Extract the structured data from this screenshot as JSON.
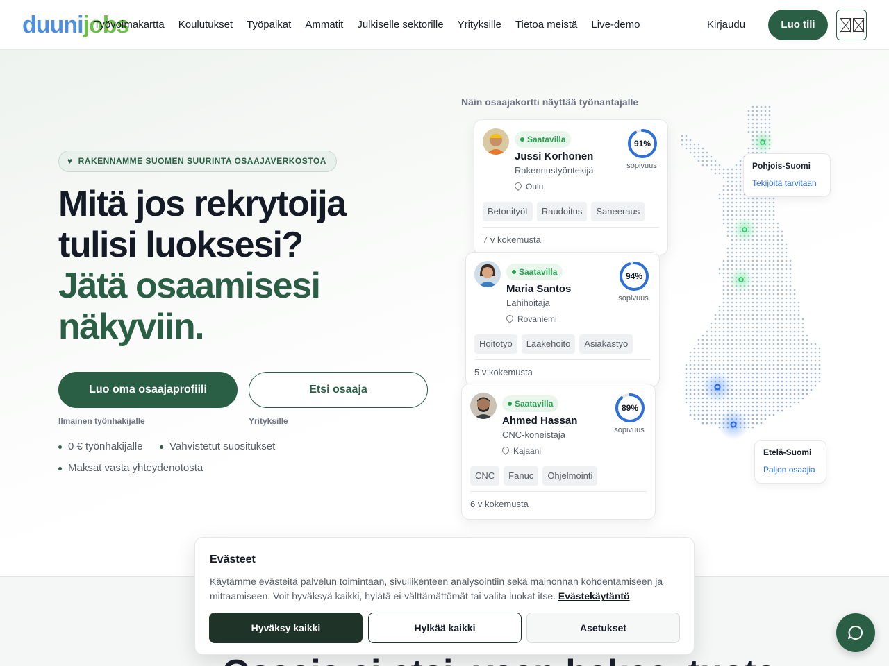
{
  "header": {
    "logo": {
      "part1": "duuni",
      "part2": "jobs"
    },
    "nav": [
      "Työvoimakartta",
      "Koulutukset",
      "Työpaikat",
      "Ammatit",
      "Julkiselle sektorille",
      "Yrityksille",
      "Tietoa meistä",
      "Live-demo"
    ],
    "login": "Kirjaudu",
    "signup": "Luo tili",
    "language_icon": "flag-icon"
  },
  "hero": {
    "pill": "RAKENNAMME SUOMEN SUURINTA OSAAJAVERKOSTOA",
    "title_lines": [
      "Mitä jos rekrytoija",
      "tulisi luoksesi?"
    ],
    "title_green_lines": [
      "Jätä osaamisesi",
      "näkyviin."
    ],
    "primary_button": "Luo oma osaajaprofiili",
    "primary_sub": "Ilmainen työnhakijalle",
    "secondary_button": "Etsi osaaja",
    "secondary_sub": "Yrityksille",
    "bullets": [
      "0 € työnhakijalle",
      "Vahvistetut suositukset",
      "Maksat vasta yhteydenotosta"
    ]
  },
  "map": {
    "caption": "Näin osaajakortti näyttää työnantajalle",
    "regions": [
      {
        "name": "Pohjois-Suomi",
        "note": "Tekijöitä tarvitaan"
      },
      {
        "name": "Etelä-Suomi",
        "note": "Paljon osaajia"
      }
    ]
  },
  "cards": [
    {
      "status": "Saatavilla",
      "name": "Jussi Korhonen",
      "role": "Rakennustyöntekijä",
      "location": "Oulu",
      "match": "91%",
      "match_value": 91,
      "match_label": "sopivuus",
      "tags": [
        "Betonityöt",
        "Raudoitus",
        "Saneeraus"
      ],
      "experience": "7 v kokemusta"
    },
    {
      "status": "Saatavilla",
      "name": "Maria Santos",
      "role": "Lähihoitaja",
      "location": "Rovaniemi",
      "match": "94%",
      "match_value": 94,
      "match_label": "sopivuus",
      "tags": [
        "Hoitotyö",
        "Lääkehoito",
        "Asiakastyö"
      ],
      "experience": "5 v kokemusta"
    },
    {
      "status": "Saatavilla",
      "name": "Ahmed Hassan",
      "role": "CNC-koneistaja",
      "location": "Kajaani",
      "match": "89%",
      "match_value": 89,
      "match_label": "sopivuus",
      "tags": [
        "CNC",
        "Fanuc",
        "Ohjelmointi"
      ],
      "experience": "6 v kokemusta"
    }
  ],
  "cookie": {
    "title": "Evästeet",
    "body": "Käytämme evästeitä palvelun toimintaan, sivuliikenteen analysointiin sekä mainonnan kohdentamiseen ja mittaamiseen. Voit hyväksyä kaikki, hylätä ei-välttämättömät tai valita luokat itse.",
    "link": "Evästekäytäntö",
    "accept": "Hyväksy kaikki",
    "reject": "Hylkää kaikki",
    "settings": "Asetukset"
  },
  "below": {
    "heading": "Osaaja ei etsi, vaan hakee, tuota"
  },
  "colors": {
    "brand_green": "#2a5f45",
    "accent_blue": "#2f6fd6",
    "status_green": "#2aa052"
  }
}
